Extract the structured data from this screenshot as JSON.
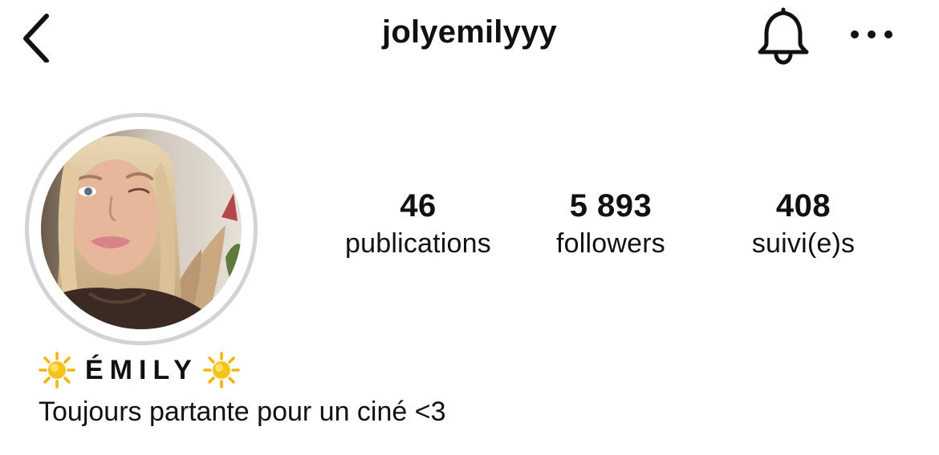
{
  "header": {
    "username": "jolyemilyyy",
    "back_icon": "chevron-left-icon",
    "notification_icon": "bell-icon",
    "more_icon": "more-horizontal-icon"
  },
  "profile": {
    "avatar": "profile-photo",
    "story_ring_color": "#d3d3d3",
    "stats": {
      "posts": {
        "value": "46",
        "label": "publications"
      },
      "followers": {
        "value": "5 893",
        "label": "followers"
      },
      "following": {
        "value": "408",
        "label": "suivi(e)s"
      }
    },
    "display_name": "ÉMILY",
    "name_emoji_left": "sun-emoji",
    "name_emoji_right": "sun-emoji",
    "bio": "Toujours partante pour un ciné <3"
  }
}
